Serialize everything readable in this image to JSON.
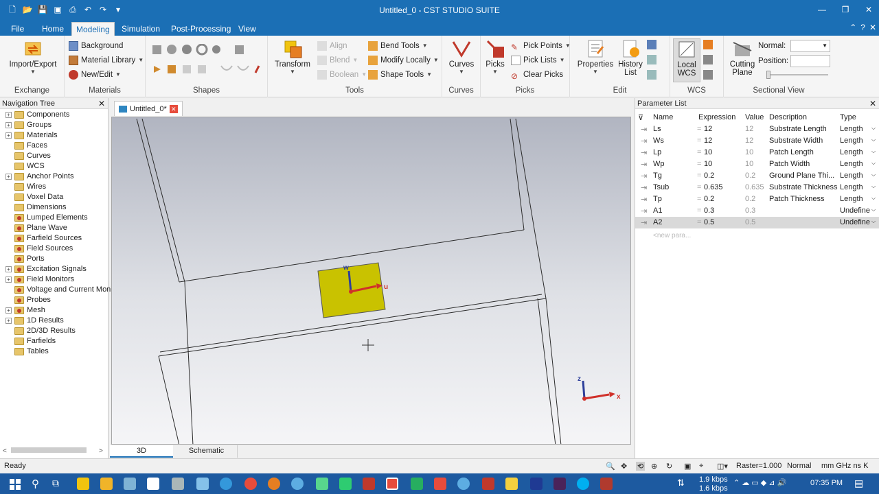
{
  "window": {
    "title": "Untitled_0 - CST STUDIO SUITE",
    "minimize": "—",
    "maximize": "❐",
    "close": "✕"
  },
  "menu": {
    "file": "File",
    "tabs": [
      "Home",
      "Modeling",
      "Simulation",
      "Post-Processing",
      "View"
    ],
    "active": "Modeling",
    "help": "?"
  },
  "ribbon": {
    "exchange": {
      "label": "Exchange",
      "import_export": "Import/Export"
    },
    "materials": {
      "label": "Materials",
      "background": "Background",
      "material_library": "Material Library",
      "new_edit": "New/Edit"
    },
    "shapes": {
      "label": "Shapes"
    },
    "tools": {
      "label": "Tools",
      "transform": "Transform",
      "align": "Align",
      "blend": "Blend",
      "boolean": "Boolean",
      "bend_tools": "Bend Tools",
      "modify_locally": "Modify Locally",
      "shape_tools": "Shape Tools"
    },
    "curves": {
      "label": "Curves",
      "curves": "Curves"
    },
    "picks": {
      "label": "Picks",
      "picks": "Picks",
      "pick_points": "Pick Points",
      "pick_lists": "Pick Lists",
      "clear_picks": "Clear Picks"
    },
    "edit": {
      "label": "Edit",
      "properties": "Properties",
      "history": "History",
      "list": "List"
    },
    "wcs": {
      "label": "WCS",
      "local": "Local",
      "wcs": "WCS"
    },
    "sectional": {
      "label": "Sectional View",
      "cutting": "Cutting",
      "plane": "Plane",
      "normal": "Normal:",
      "position": "Position:"
    }
  },
  "nav_tree": {
    "title": "Navigation Tree",
    "items": [
      {
        "label": "Components",
        "expand": true,
        "icon": "folder"
      },
      {
        "label": "Groups",
        "expand": true,
        "icon": "folder"
      },
      {
        "label": "Materials",
        "expand": true,
        "icon": "folder"
      },
      {
        "label": "Faces",
        "expand": false,
        "icon": "folder"
      },
      {
        "label": "Curves",
        "expand": false,
        "icon": "folder"
      },
      {
        "label": "WCS",
        "expand": false,
        "icon": "folder"
      },
      {
        "label": "Anchor Points",
        "expand": true,
        "icon": "folder"
      },
      {
        "label": "Wires",
        "expand": false,
        "icon": "folder"
      },
      {
        "label": "Voxel Data",
        "expand": false,
        "icon": "folder"
      },
      {
        "label": "Dimensions",
        "expand": false,
        "icon": "folder"
      },
      {
        "label": "Lumped Elements",
        "expand": false,
        "icon": "folder-red"
      },
      {
        "label": "Plane Wave",
        "expand": false,
        "icon": "folder-red"
      },
      {
        "label": "Farfield Sources",
        "expand": false,
        "icon": "folder-red"
      },
      {
        "label": "Field Sources",
        "expand": false,
        "icon": "folder-red"
      },
      {
        "label": "Ports",
        "expand": false,
        "icon": "folder-red"
      },
      {
        "label": "Excitation Signals",
        "expand": true,
        "icon": "folder-red"
      },
      {
        "label": "Field Monitors",
        "expand": true,
        "icon": "folder-red"
      },
      {
        "label": "Voltage and Current Moni",
        "expand": false,
        "icon": "folder-red"
      },
      {
        "label": "Probes",
        "expand": false,
        "icon": "folder-red"
      },
      {
        "label": "Mesh",
        "expand": true,
        "icon": "folder-red"
      },
      {
        "label": "1D Results",
        "expand": true,
        "icon": "folder"
      },
      {
        "label": "2D/3D Results",
        "expand": false,
        "icon": "folder"
      },
      {
        "label": "Farfields",
        "expand": false,
        "icon": "folder"
      },
      {
        "label": "Tables",
        "expand": false,
        "icon": "folder"
      }
    ]
  },
  "doc_tab": {
    "label": "Untitled_0*"
  },
  "viewport": {
    "axis_w": "w",
    "axis_u": "u",
    "axis_z": "z",
    "axis_x": "x"
  },
  "view_tabs": {
    "tab_3d": "3D",
    "schematic": "Schematic"
  },
  "param_list": {
    "title": "Parameter List",
    "headers": {
      "name": "Name",
      "expression": "Expression",
      "value": "Value",
      "description": "Description",
      "type": "Type"
    },
    "rows": [
      {
        "name": "Ls",
        "expression": "12",
        "value": "12",
        "description": "Substrate Length",
        "type": "Length"
      },
      {
        "name": "Ws",
        "expression": "12",
        "value": "12",
        "description": "Substrate Width",
        "type": "Length"
      },
      {
        "name": "Lp",
        "expression": "10",
        "value": "10",
        "description": "Patch Length",
        "type": "Length"
      },
      {
        "name": "Wp",
        "expression": "10",
        "value": "10",
        "description": "Patch Width",
        "type": "Length"
      },
      {
        "name": "Tg",
        "expression": "0.2",
        "value": "0.2",
        "description": "Ground Plane Thi...",
        "type": "Length"
      },
      {
        "name": "Tsub",
        "expression": "0.635",
        "value": "0.635",
        "description": "Substrate Thickness",
        "type": "Length"
      },
      {
        "name": "Tp",
        "expression": "0.2",
        "value": "0.2",
        "description": "Patch Thickness",
        "type": "Length"
      },
      {
        "name": "A1",
        "expression": "0.3",
        "value": "0.3",
        "description": "",
        "type": "Undefine"
      },
      {
        "name": "A2",
        "expression": "0.5",
        "value": "0.5",
        "description": "",
        "type": "Undefine"
      }
    ],
    "selected_row": "A2",
    "new_param": "<new para..."
  },
  "status": {
    "ready": "Ready",
    "raster": "Raster=1.000",
    "mode": "Normal",
    "units": "mm  GHz  ns  K"
  },
  "taskbar": {
    "up_speed": "1.9 kbps",
    "down_speed": "1.6 kbps",
    "time": "07:35 PM"
  },
  "colors": {
    "accent": "#1b6fb5",
    "patch": "#c9c200",
    "taskbar": "#1d5aa0"
  }
}
